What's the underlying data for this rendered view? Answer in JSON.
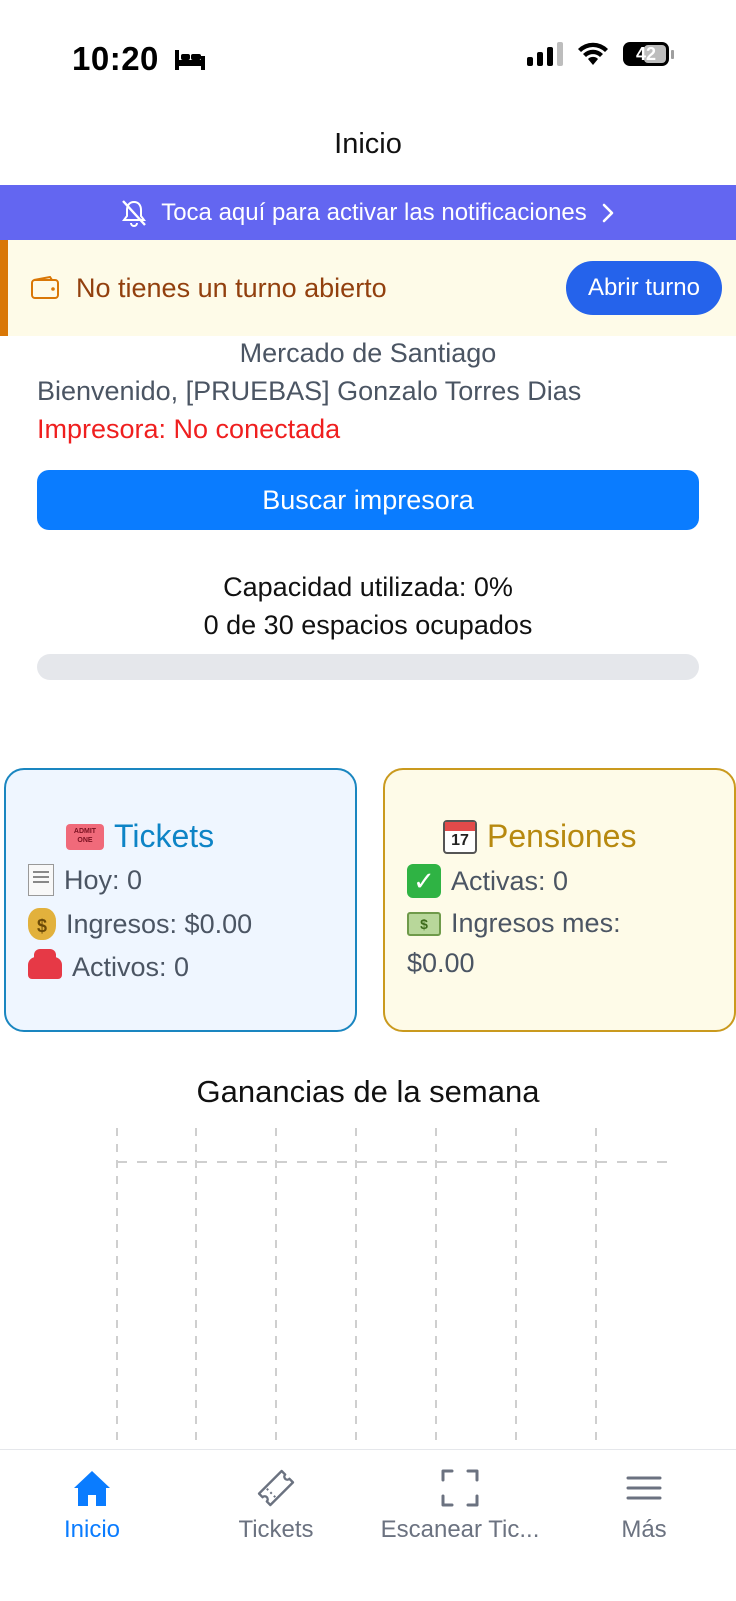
{
  "status_bar": {
    "time": "10:20",
    "battery": "42"
  },
  "header": {
    "title": "Inicio"
  },
  "notifications_banner": {
    "text": "Toca aquí para activar las notificaciones"
  },
  "shift_banner": {
    "text": "No tienes un turno abierto",
    "button_label": "Abrir turno"
  },
  "info": {
    "location": "Mercado de Santiago",
    "welcome": "Bienvenido, [PRUEBAS] Gonzalo Torres Dias",
    "printer_status": "Impresora: No conectada",
    "search_printer_label": "Buscar impresora"
  },
  "capacity": {
    "percent_text": "Capacidad utilizada: 0%",
    "occupied_text": "0 de 30 espacios ocupados",
    "fraction": 0
  },
  "tickets_card": {
    "title": "Tickets",
    "today": "Hoy: 0",
    "income": "Ingresos: $0.00",
    "active": "Activos: 0"
  },
  "pensiones_card": {
    "title": "Pensiones",
    "active": "Activas: 0",
    "income_label": "Ingresos mes:",
    "income_value": "$0.00",
    "calendar_day": "17"
  },
  "chart_data": {
    "type": "bar",
    "title": "Ganancias de la semana",
    "categories": [],
    "values": [],
    "grid": true
  },
  "tabbar": {
    "items": [
      {
        "label": "Inicio",
        "icon": "home-icon",
        "active": true
      },
      {
        "label": "Tickets",
        "icon": "ticket-icon",
        "active": false
      },
      {
        "label": "Escanear Tic...",
        "icon": "scan-icon",
        "active": false
      },
      {
        "label": "Más",
        "icon": "menu-icon",
        "active": false
      }
    ]
  },
  "colors": {
    "accent": "#0a7cff",
    "notification_banner": "#6366f1",
    "shift_button": "#2563eb",
    "error": "#ef1f1f",
    "tickets": "#0d84c6",
    "pensiones": "#b7890f"
  }
}
